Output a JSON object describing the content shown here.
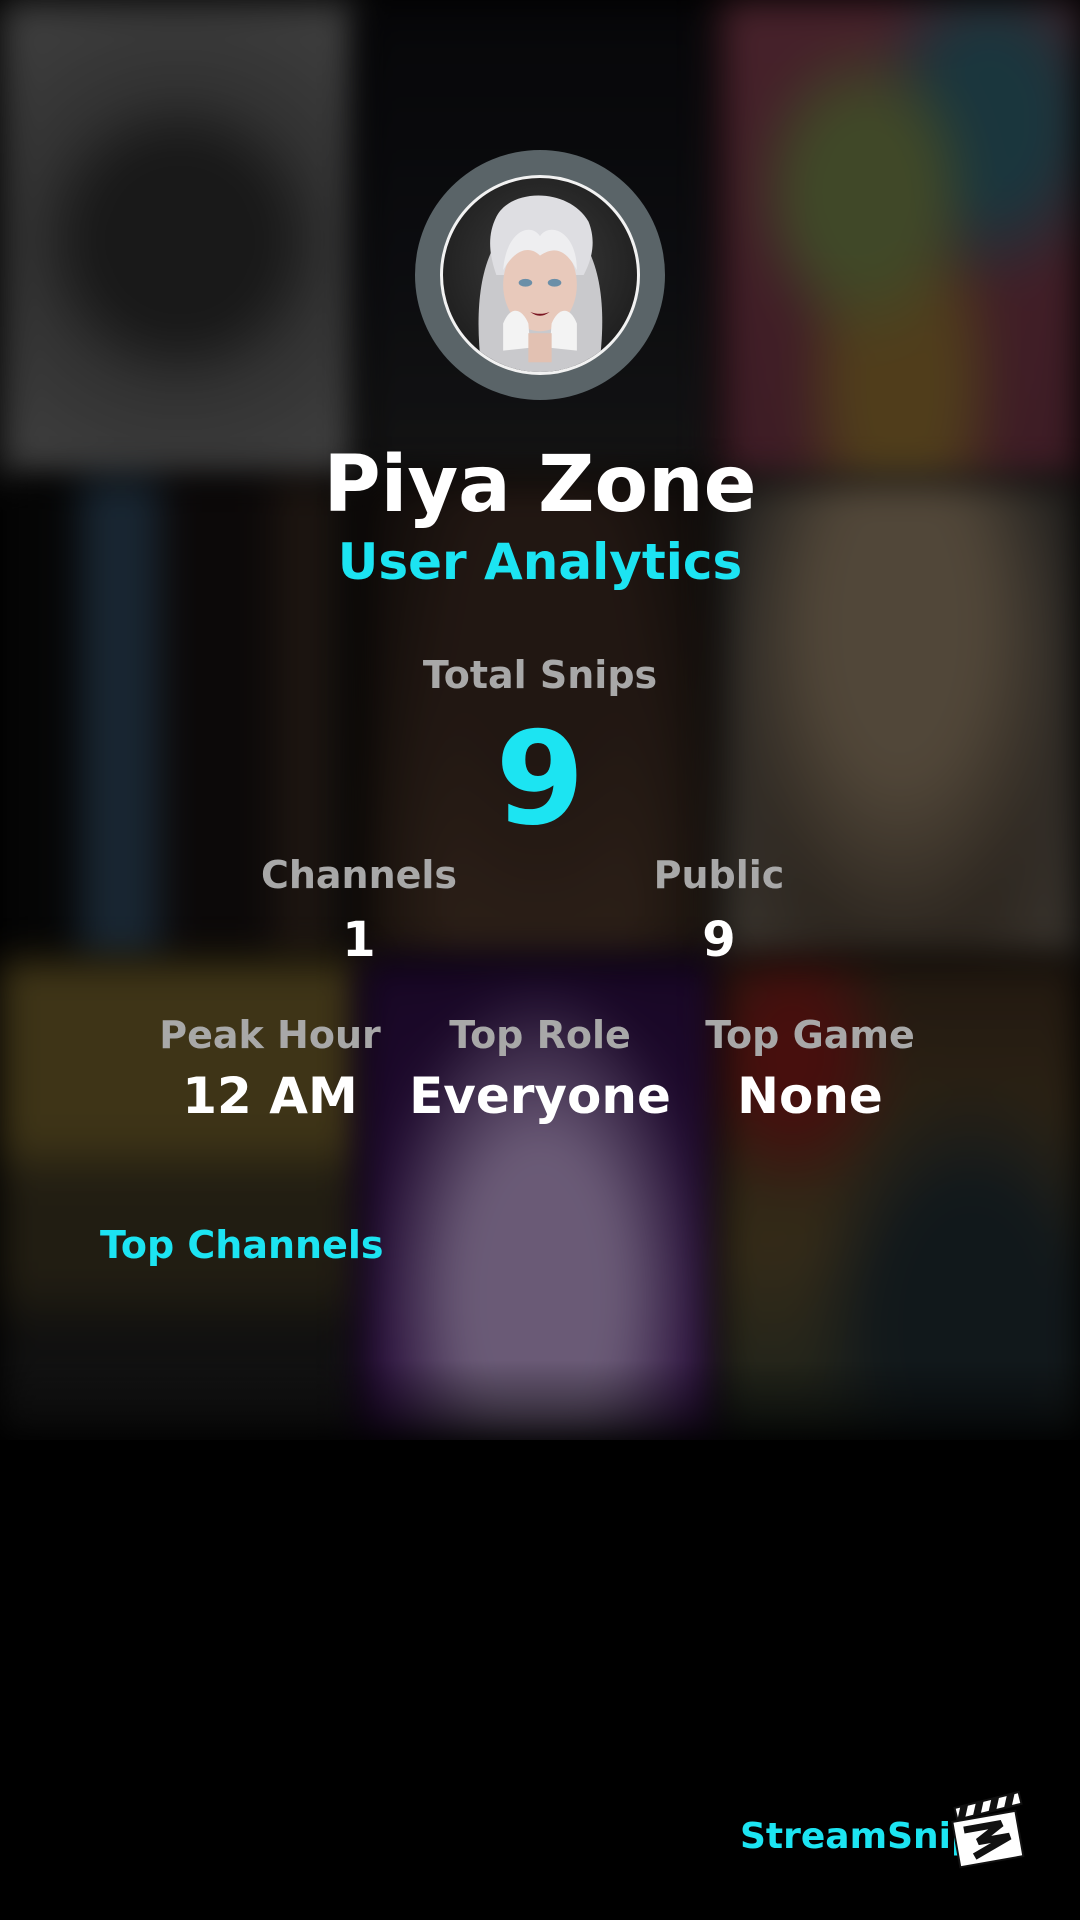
{
  "profile": {
    "name": "Piya Zone",
    "subtitle": "User Analytics",
    "avatar_icon": "user-avatar"
  },
  "totals": {
    "label": "Total Snips",
    "value": "9"
  },
  "stats_row1": [
    {
      "label": "Channels",
      "value": "1"
    },
    {
      "label": "Public",
      "value": "9"
    }
  ],
  "stats_row2": [
    {
      "label": "Peak Hour",
      "value": "12 AM"
    },
    {
      "label": "Top Role",
      "value": "Everyone"
    },
    {
      "label": "Top Game",
      "value": "None"
    }
  ],
  "sections": {
    "top_channels": "Top Channels"
  },
  "brand": {
    "name": "StreamSnip",
    "logo_icon": "clapperboard-icon"
  },
  "colors": {
    "accent": "#1ce4f2",
    "label_gray": "#a8a8a8",
    "value_white": "#ffffff",
    "background": "#000000"
  }
}
